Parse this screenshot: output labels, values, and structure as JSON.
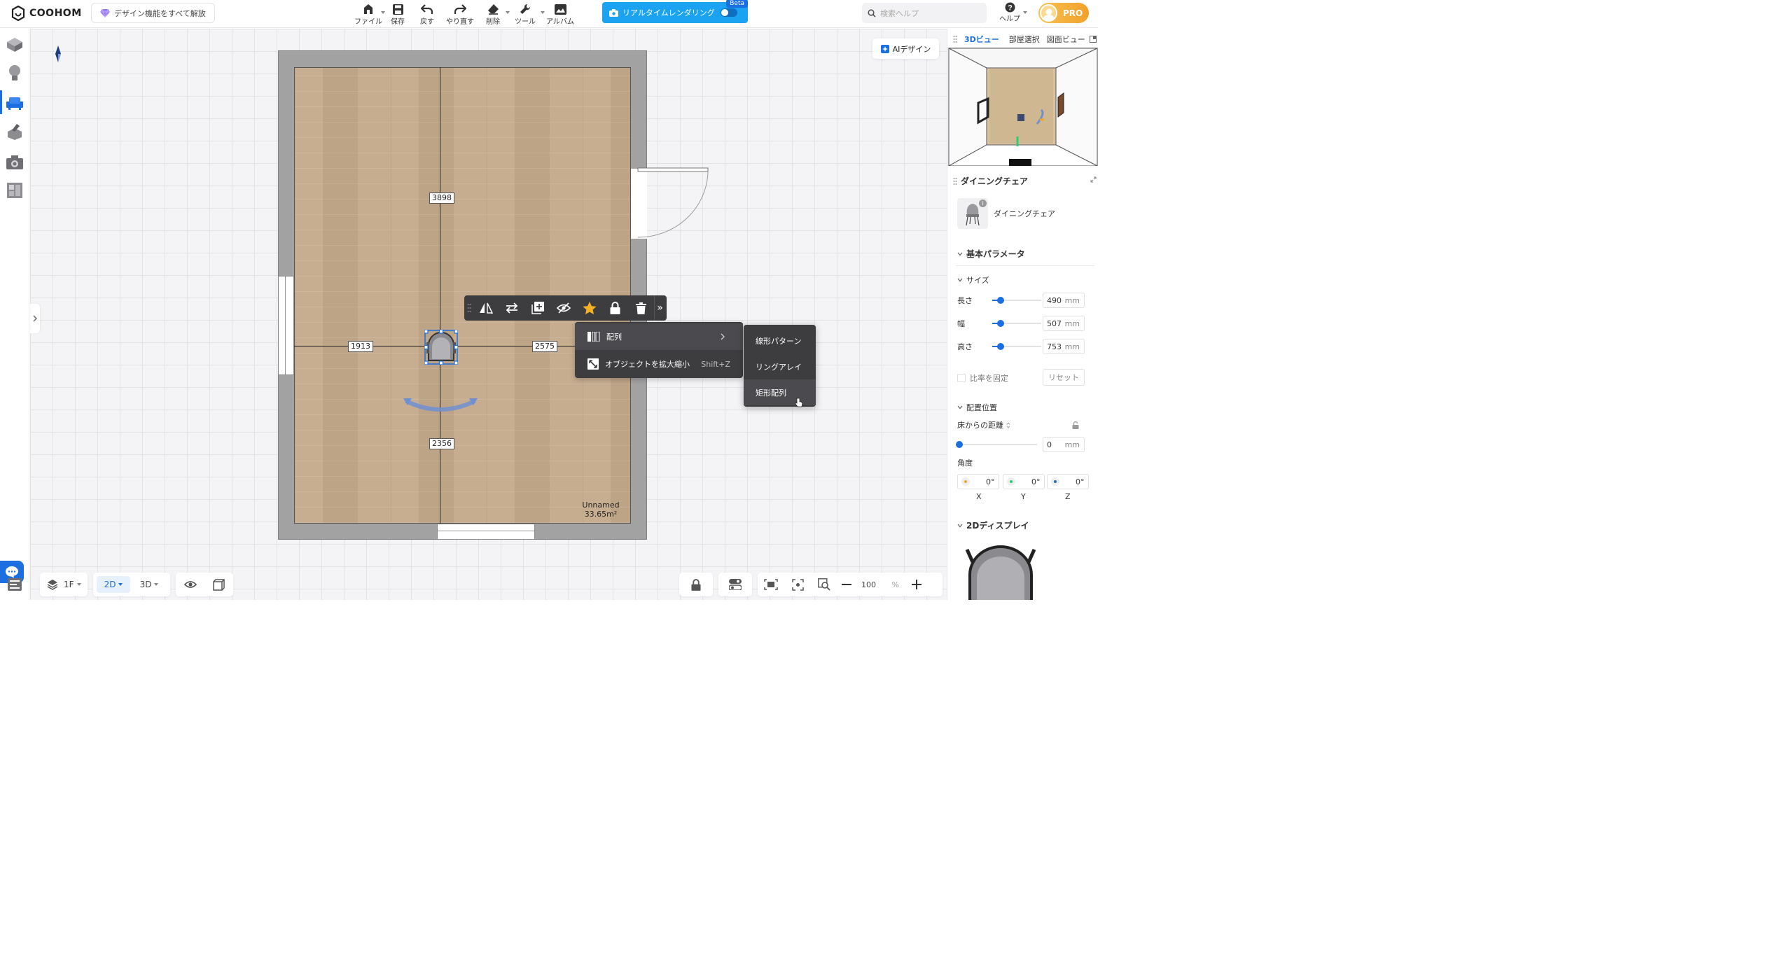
{
  "topbar": {
    "logo": "COOHOM",
    "unlock_label": "デザイン機能をすべて解放",
    "tools": [
      {
        "label": "ファイル",
        "icon": "file-icon",
        "caret": true
      },
      {
        "label": "保存",
        "icon": "save-icon",
        "caret": false
      },
      {
        "label": "戻す",
        "icon": "undo-icon",
        "caret": false
      },
      {
        "label": "やり直す",
        "icon": "redo-icon",
        "caret": false
      },
      {
        "label": "削除",
        "icon": "eraser-icon",
        "caret": true
      },
      {
        "label": "ツール",
        "icon": "wrench-icon",
        "caret": true
      },
      {
        "label": "アルバム",
        "icon": "album-icon",
        "caret": false
      }
    ],
    "render_label": "リアルタイムレンダリング",
    "beta": "Beta",
    "search_placeholder": "検索ヘルプ",
    "help_label": "ヘルプ",
    "pro_label": "PRO"
  },
  "leftrail": {
    "items": [
      "box-icon",
      "bulb-icon",
      "sofa-icon",
      "build-icon",
      "camera-icon",
      "layout-icon"
    ],
    "active_index": 2
  },
  "canvas": {
    "ai_design": "AIデザイン",
    "dims": {
      "top": "3898",
      "left": "1913",
      "right": "2575",
      "bottom": "2356"
    },
    "room_name": "Unnamed",
    "room_area": "33.65m²",
    "toolbar_icons": [
      "mirror-icon",
      "swap-icon",
      "duplicate-icon",
      "hide-icon",
      "favorite-icon",
      "lock-icon",
      "delete-icon",
      "more-icon"
    ],
    "context_menu": {
      "items": [
        {
          "label": "配列",
          "icon": "array-icon",
          "shortcut": "",
          "submenu": true
        },
        {
          "label": "オブジェクトを拡大縮小",
          "icon": "scale-icon",
          "shortcut": "Shift+Z",
          "submenu": false
        }
      ]
    },
    "submenu": {
      "items": [
        "線形パターン",
        "リングアレイ",
        "矩形配列"
      ],
      "highlight_index": 2
    }
  },
  "bottom": {
    "floor": "1F",
    "view_2d": "2D",
    "view_3d": "3D",
    "zoom_value": "100",
    "zoom_unit": "%"
  },
  "rightpanel": {
    "tabs": [
      "3Dビュー",
      "部屋選択",
      "図面ビュー"
    ],
    "active_tab": 0,
    "object_title": "ダイニングチェア",
    "object_name": "ダイニングチェア",
    "basic_params": "基本パラメータ",
    "size_label": "サイズ",
    "size_rows": [
      {
        "label": "長さ",
        "value": "490",
        "unit": "mm"
      },
      {
        "label": "幅",
        "value": "507",
        "unit": "mm"
      },
      {
        "label": "高さ",
        "value": "753",
        "unit": "mm"
      }
    ],
    "lock_ratio": "比率を固定",
    "reset": "リセット",
    "placement": "配置位置",
    "floor_distance": "床からの距離",
    "floor_distance_value": "0",
    "floor_distance_unit": "mm",
    "angle_label": "角度",
    "angles": [
      {
        "axis": "X",
        "value": "0°",
        "color": "#f5a623"
      },
      {
        "axis": "Y",
        "value": "0°",
        "color": "#2ecc71"
      },
      {
        "axis": "Z",
        "value": "0°",
        "color": "#1c6fe0"
      }
    ],
    "display2d": "2Dディスプレイ"
  }
}
